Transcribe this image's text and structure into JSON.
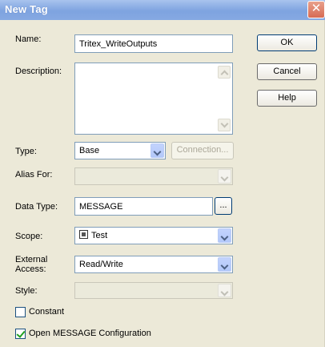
{
  "window": {
    "title": "New Tag",
    "close_glyph": "✕"
  },
  "form": {
    "name_label": "Name:",
    "name_value": "Tritex_WriteOutputs",
    "description_label": "Description:",
    "description_value": "",
    "type_label": "Type:",
    "type_value": "Base",
    "connection_label": "Connection...",
    "alias_label": "Alias For:",
    "alias_value": "",
    "data_type_label": "Data Type:",
    "data_type_value": "MESSAGE",
    "browse_label": "...",
    "scope_label": "Scope:",
    "scope_value": "Test",
    "external_access_label_line1": "External",
    "external_access_label_line2": "Access:",
    "external_access_value": "Read/Write",
    "style_label": "Style:",
    "style_value": "",
    "constant_label": "Constant",
    "constant_checked": false,
    "open_config_label": "Open MESSAGE Configuration",
    "open_config_checked": true
  },
  "buttons": {
    "ok": "OK",
    "cancel": "Cancel",
    "help": "Help"
  },
  "colors": {
    "titlebar": "#86a9e2",
    "dialog_bg": "#ece9d8",
    "close_button": "#d76b54",
    "field_border": "#7f9db9"
  }
}
